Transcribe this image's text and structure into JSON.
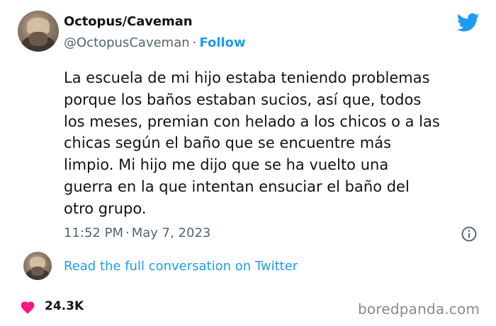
{
  "user": {
    "display_name": "Octopus/Caveman",
    "handle": "@OctopusCaveman",
    "separator": "·",
    "follow_label": "Follow"
  },
  "tweet": {
    "text": "La escuela de mi hijo estaba teniendo problemas\nporque los baños estaban sucios, así que, todos\nlos meses, premian con helado a los chicos o a las\nchicas según el baño que se encuentre más\nlimpio. Mi hijo me dijo que se ha vuelto una\nguerra en la que intentan ensuciar el baño del\notro grupo.",
    "time": "11:52 PM",
    "date": "May 7, 2023",
    "separator": "·"
  },
  "conversation": {
    "link_label": "Read the full conversation on Twitter"
  },
  "engagement": {
    "likes": "24.3K"
  },
  "watermark": {
    "text": "boredpanda.com"
  },
  "icons": {
    "brand": "twitter-bird-icon",
    "info": "info-icon",
    "like": "heart-icon"
  },
  "colors": {
    "accent": "#1d9bf0",
    "text": "#0f1419",
    "secondary": "#536471",
    "heart": "#f91880"
  }
}
